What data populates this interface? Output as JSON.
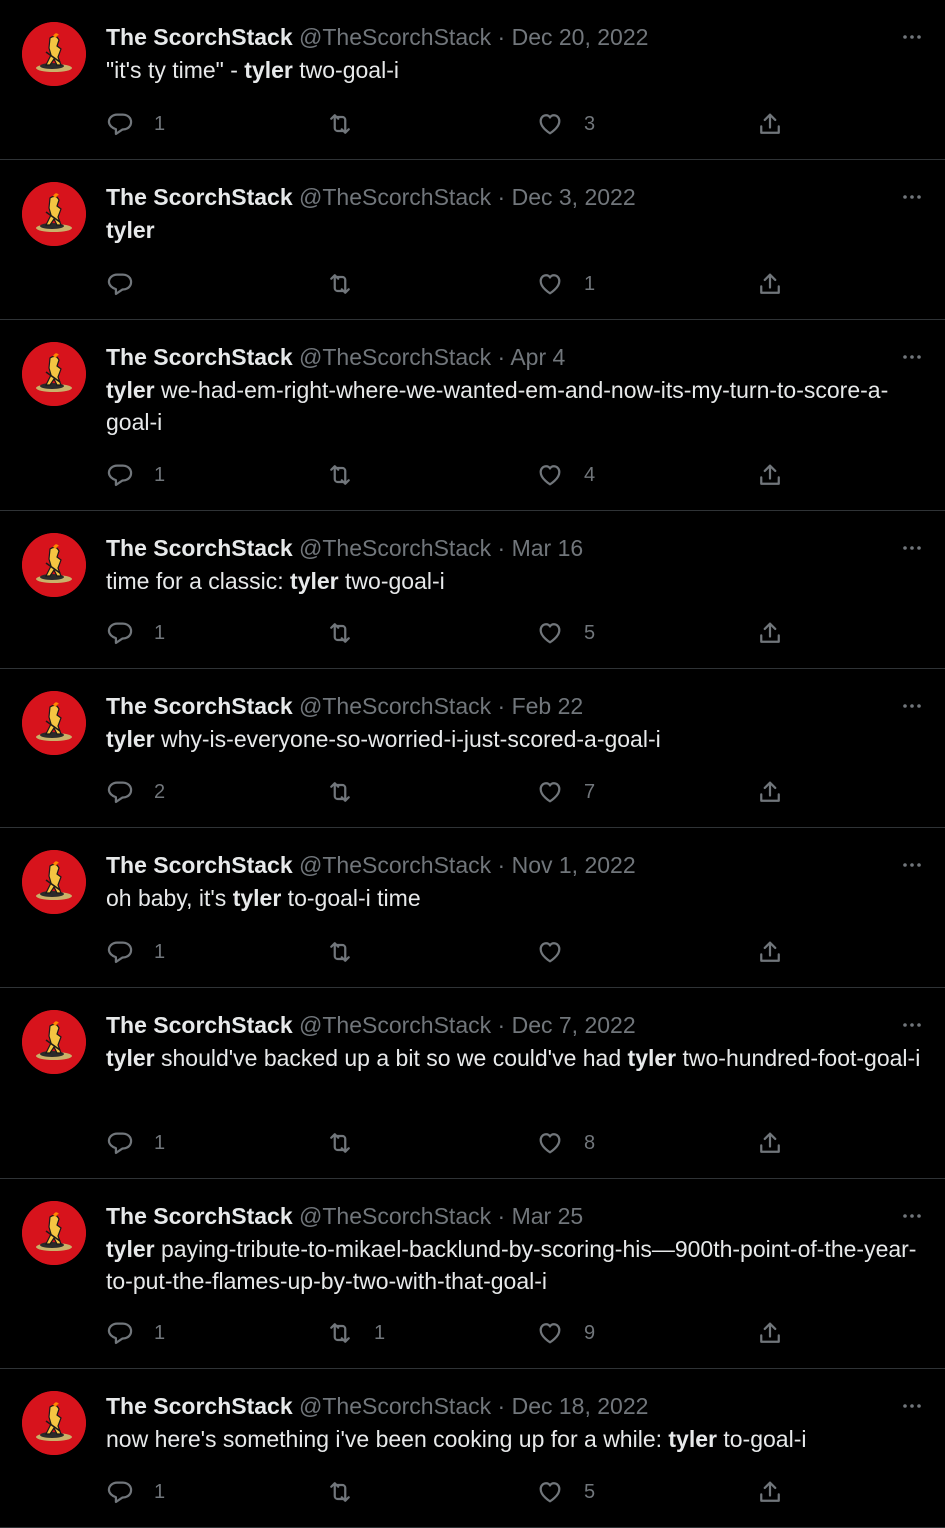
{
  "accent": "#d7131c",
  "tweets": [
    {
      "name": "The ScorchStack",
      "handle": "@TheScorchStack",
      "sep": "·",
      "date": "Dec 20, 2022",
      "text": [
        {
          "t": "\"it's ty time\" - "
        },
        {
          "t": "tyler",
          "b": true
        },
        {
          "t": " two-goal-i"
        }
      ],
      "replies": "1",
      "retweets": "",
      "likes": "3",
      "h": 160
    },
    {
      "name": "The ScorchStack",
      "handle": "@TheScorchStack",
      "sep": "·",
      "date": "Dec 3, 2022",
      "text": [
        {
          "t": "tyler",
          "b": true
        }
      ],
      "replies": "",
      "retweets": "",
      "likes": "1",
      "h": 160
    },
    {
      "name": "The ScorchStack",
      "handle": "@TheScorchStack",
      "sep": "·",
      "date": "Apr 4",
      "text": [
        {
          "t": "tyler",
          "b": true
        },
        {
          "t": " we-had-em-right-where-we-wanted-em-and-now-its-my-turn-to-score-a-goal-i"
        }
      ],
      "replies": "1",
      "retweets": "",
      "likes": "4",
      "h": 191
    },
    {
      "name": "The ScorchStack",
      "handle": "@TheScorchStack",
      "sep": "·",
      "date": "Mar 16",
      "text": [
        {
          "t": "time for a classic: "
        },
        {
          "t": "tyler",
          "b": true
        },
        {
          "t": " two-goal-i"
        }
      ],
      "replies": "1",
      "retweets": "",
      "likes": "5",
      "h": 158
    },
    {
      "name": "The ScorchStack",
      "handle": "@TheScorchStack",
      "sep": "·",
      "date": "Feb 22",
      "text": [
        {
          "t": "tyler",
          "b": true
        },
        {
          "t": " why-is-everyone-so-worried-i-just-scored-a-goal-i"
        }
      ],
      "replies": "2",
      "retweets": "",
      "likes": "7",
      "h": 159
    },
    {
      "name": "The ScorchStack",
      "handle": "@TheScorchStack",
      "sep": "·",
      "date": "Nov 1, 2022",
      "text": [
        {
          "t": "oh baby, it's "
        },
        {
          "t": "tyler",
          "b": true
        },
        {
          "t": " to-goal-i time"
        }
      ],
      "replies": "1",
      "retweets": "",
      "likes": "",
      "h": 160
    },
    {
      "name": "The ScorchStack",
      "handle": "@TheScorchStack",
      "sep": "·",
      "date": "Dec 7, 2022",
      "text": [
        {
          "t": "tyler",
          "b": true
        },
        {
          "t": " should've backed up a bit so we could've had "
        },
        {
          "t": "tyler",
          "b": true
        },
        {
          "t": " two-hundred-foot-goal-i"
        }
      ],
      "replies": "1",
      "retweets": "",
      "likes": "8",
      "h": 191
    },
    {
      "name": "The ScorchStack",
      "handle": "@TheScorchStack",
      "sep": "·",
      "date": "Mar 25",
      "text": [
        {
          "t": "tyler",
          "b": true
        },
        {
          "t": " paying-tribute-to-mikael-backlund-by-scoring-his—900th-point-of-the-year-to-put-the-flames-up-by-two-with-that-goal-i"
        }
      ],
      "replies": "1",
      "retweets": "1",
      "likes": "9",
      "h": 190
    },
    {
      "name": "The ScorchStack",
      "handle": "@TheScorchStack",
      "sep": "·",
      "date": "Dec 18, 2022",
      "text": [
        {
          "t": "now here's something i've been cooking up for a while: "
        },
        {
          "t": "tyler",
          "b": true
        },
        {
          "t": " to-goal-i"
        }
      ],
      "replies": "1",
      "retweets": "",
      "likes": "5",
      "h": 159
    }
  ]
}
